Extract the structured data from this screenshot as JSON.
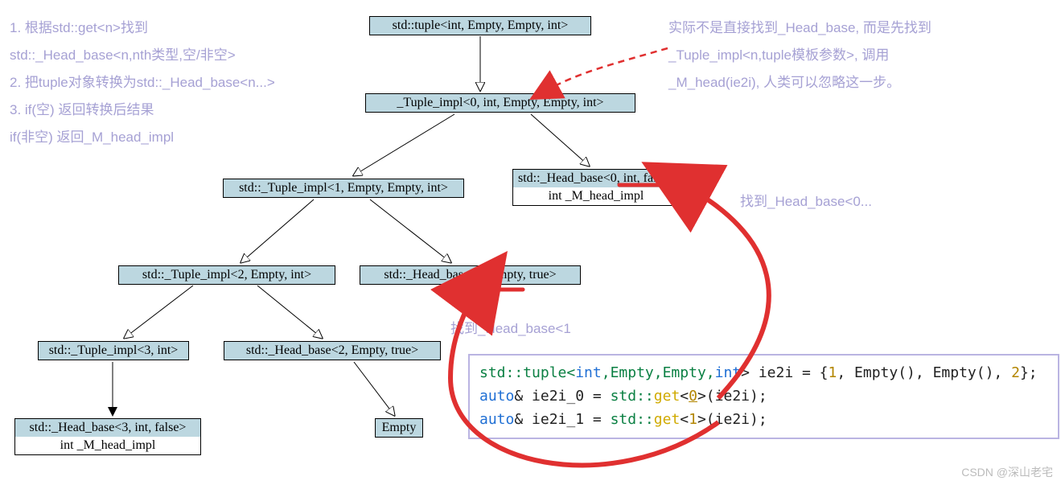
{
  "nodes": {
    "n0": "std::tuple<int, Empty, Empty, int>",
    "n1": "_Tuple_impl<0, int, Empty, Empty, int>",
    "n2": "std::_Tuple_impl<1, Empty, Empty, int>",
    "n3": "std::_Head_base<0, int, false>",
    "n3b": "int _M_head_impl",
    "n4": "std::_Tuple_impl<2, Empty, int>",
    "n5": "std::_Head_base<1, Empty, true>",
    "n6": "std::_Tuple_impl<3, int>",
    "n7": "std::_Head_base<2, Empty, true>",
    "n8": "std::_Head_base<3, int, false>",
    "n8b": "int _M_head_impl",
    "n9": "Empty"
  },
  "annot_left": {
    "l1": "1. 根据std::get<n>找到",
    "l2": "    std::_Head_base<n,nth类型,空/非空>",
    "l3": "2. 把tuple对象转换为std::_Head_base<n...>",
    "l4": "3. if(空)  返回转换后结果",
    "l5": "   if(非空) 返回_M_head_impl"
  },
  "annot_right": {
    "r1": "实际不是直接找到_Head_base, 而是先找到",
    "r2": "_Tuple_impl<n,tuple模板参数>, 调用",
    "r3": "_M_head(ie2i), 人类可以忽略这一步。"
  },
  "annot_find0": "找到_Head_base<0...",
  "annot_find1": "找到_Head_base<1",
  "code": {
    "line1": {
      "p1": "std::tuple<",
      "p2": "int",
      "p3": ",Empty,Empty,",
      "p4": "int",
      "p5": "> ie2i = {",
      "p6": "1",
      "p7": ", Empty(), Empty(), ",
      "p8": "2",
      "p9": "};"
    },
    "line2": {
      "p1": "auto",
      "p2": "& ie2i_0 = ",
      "p3": "std::",
      "p4": "get",
      "p5": "<",
      "p6": "0",
      "p7": ">(ie2i);"
    },
    "line3": {
      "p1": "auto",
      "p2": "& ie2i_1 = ",
      "p3": "std::",
      "p4": "get",
      "p5": "<",
      "p6": "1",
      "p7": ">(ie2i);"
    }
  },
  "watermark": "CSDN @深山老宅"
}
